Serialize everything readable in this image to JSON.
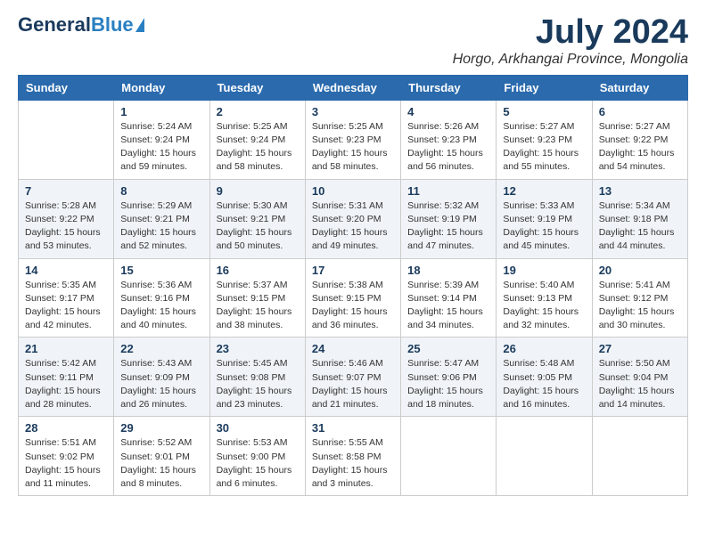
{
  "header": {
    "logo_line1": "General",
    "logo_line2": "Blue",
    "month": "July 2024",
    "location": "Horgo, Arkhangai Province, Mongolia"
  },
  "weekdays": [
    "Sunday",
    "Monday",
    "Tuesday",
    "Wednesday",
    "Thursday",
    "Friday",
    "Saturday"
  ],
  "weeks": [
    [
      {
        "date": "",
        "info": ""
      },
      {
        "date": "1",
        "info": "Sunrise: 5:24 AM\nSunset: 9:24 PM\nDaylight: 15 hours\nand 59 minutes."
      },
      {
        "date": "2",
        "info": "Sunrise: 5:25 AM\nSunset: 9:24 PM\nDaylight: 15 hours\nand 58 minutes."
      },
      {
        "date": "3",
        "info": "Sunrise: 5:25 AM\nSunset: 9:23 PM\nDaylight: 15 hours\nand 58 minutes."
      },
      {
        "date": "4",
        "info": "Sunrise: 5:26 AM\nSunset: 9:23 PM\nDaylight: 15 hours\nand 56 minutes."
      },
      {
        "date": "5",
        "info": "Sunrise: 5:27 AM\nSunset: 9:23 PM\nDaylight: 15 hours\nand 55 minutes."
      },
      {
        "date": "6",
        "info": "Sunrise: 5:27 AM\nSunset: 9:22 PM\nDaylight: 15 hours\nand 54 minutes."
      }
    ],
    [
      {
        "date": "7",
        "info": "Sunrise: 5:28 AM\nSunset: 9:22 PM\nDaylight: 15 hours\nand 53 minutes."
      },
      {
        "date": "8",
        "info": "Sunrise: 5:29 AM\nSunset: 9:21 PM\nDaylight: 15 hours\nand 52 minutes."
      },
      {
        "date": "9",
        "info": "Sunrise: 5:30 AM\nSunset: 9:21 PM\nDaylight: 15 hours\nand 50 minutes."
      },
      {
        "date": "10",
        "info": "Sunrise: 5:31 AM\nSunset: 9:20 PM\nDaylight: 15 hours\nand 49 minutes."
      },
      {
        "date": "11",
        "info": "Sunrise: 5:32 AM\nSunset: 9:19 PM\nDaylight: 15 hours\nand 47 minutes."
      },
      {
        "date": "12",
        "info": "Sunrise: 5:33 AM\nSunset: 9:19 PM\nDaylight: 15 hours\nand 45 minutes."
      },
      {
        "date": "13",
        "info": "Sunrise: 5:34 AM\nSunset: 9:18 PM\nDaylight: 15 hours\nand 44 minutes."
      }
    ],
    [
      {
        "date": "14",
        "info": "Sunrise: 5:35 AM\nSunset: 9:17 PM\nDaylight: 15 hours\nand 42 minutes."
      },
      {
        "date": "15",
        "info": "Sunrise: 5:36 AM\nSunset: 9:16 PM\nDaylight: 15 hours\nand 40 minutes."
      },
      {
        "date": "16",
        "info": "Sunrise: 5:37 AM\nSunset: 9:15 PM\nDaylight: 15 hours\nand 38 minutes."
      },
      {
        "date": "17",
        "info": "Sunrise: 5:38 AM\nSunset: 9:15 PM\nDaylight: 15 hours\nand 36 minutes."
      },
      {
        "date": "18",
        "info": "Sunrise: 5:39 AM\nSunset: 9:14 PM\nDaylight: 15 hours\nand 34 minutes."
      },
      {
        "date": "19",
        "info": "Sunrise: 5:40 AM\nSunset: 9:13 PM\nDaylight: 15 hours\nand 32 minutes."
      },
      {
        "date": "20",
        "info": "Sunrise: 5:41 AM\nSunset: 9:12 PM\nDaylight: 15 hours\nand 30 minutes."
      }
    ],
    [
      {
        "date": "21",
        "info": "Sunrise: 5:42 AM\nSunset: 9:11 PM\nDaylight: 15 hours\nand 28 minutes."
      },
      {
        "date": "22",
        "info": "Sunrise: 5:43 AM\nSunset: 9:09 PM\nDaylight: 15 hours\nand 26 minutes."
      },
      {
        "date": "23",
        "info": "Sunrise: 5:45 AM\nSunset: 9:08 PM\nDaylight: 15 hours\nand 23 minutes."
      },
      {
        "date": "24",
        "info": "Sunrise: 5:46 AM\nSunset: 9:07 PM\nDaylight: 15 hours\nand 21 minutes."
      },
      {
        "date": "25",
        "info": "Sunrise: 5:47 AM\nSunset: 9:06 PM\nDaylight: 15 hours\nand 18 minutes."
      },
      {
        "date": "26",
        "info": "Sunrise: 5:48 AM\nSunset: 9:05 PM\nDaylight: 15 hours\nand 16 minutes."
      },
      {
        "date": "27",
        "info": "Sunrise: 5:50 AM\nSunset: 9:04 PM\nDaylight: 15 hours\nand 14 minutes."
      }
    ],
    [
      {
        "date": "28",
        "info": "Sunrise: 5:51 AM\nSunset: 9:02 PM\nDaylight: 15 hours\nand 11 minutes."
      },
      {
        "date": "29",
        "info": "Sunrise: 5:52 AM\nSunset: 9:01 PM\nDaylight: 15 hours\nand 8 minutes."
      },
      {
        "date": "30",
        "info": "Sunrise: 5:53 AM\nSunset: 9:00 PM\nDaylight: 15 hours\nand 6 minutes."
      },
      {
        "date": "31",
        "info": "Sunrise: 5:55 AM\nSunset: 8:58 PM\nDaylight: 15 hours\nand 3 minutes."
      },
      {
        "date": "",
        "info": ""
      },
      {
        "date": "",
        "info": ""
      },
      {
        "date": "",
        "info": ""
      }
    ]
  ]
}
